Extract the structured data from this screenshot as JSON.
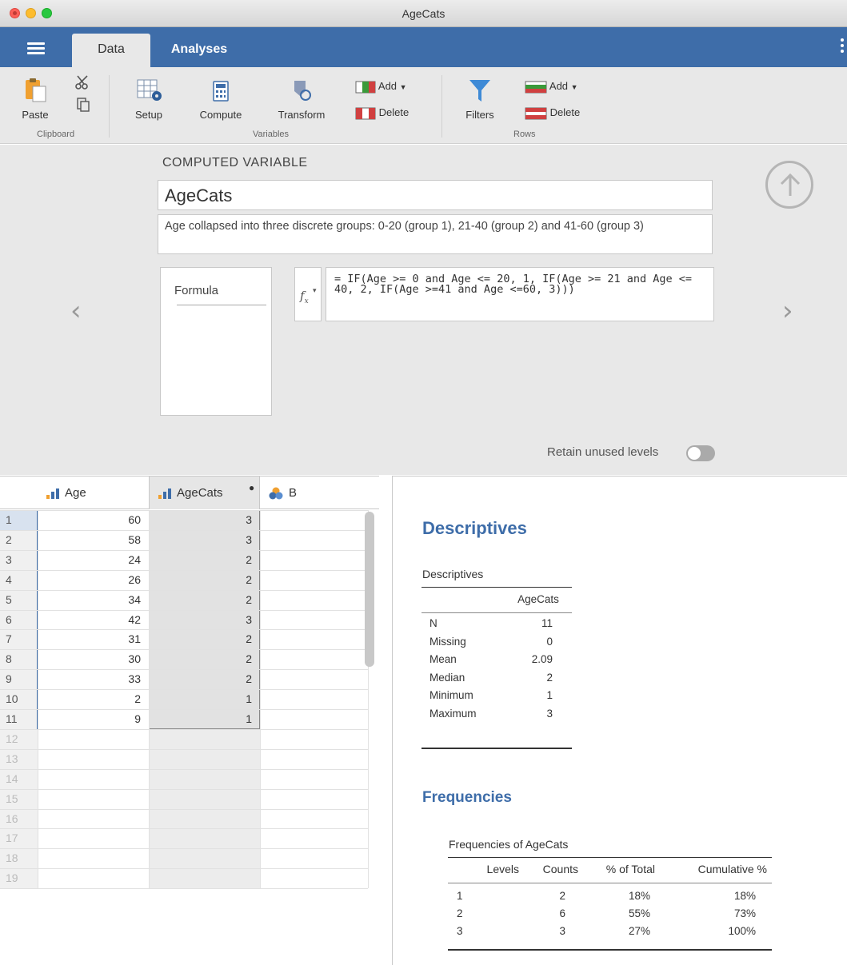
{
  "window": {
    "title": "AgeCats"
  },
  "tabs": {
    "data": "Data",
    "analyses": "Analyses"
  },
  "ribbon": {
    "paste": "Paste",
    "clipboard_group": "Clipboard",
    "setup": "Setup",
    "compute": "Compute",
    "transform": "Transform",
    "variables_group": "Variables",
    "col_add": "Add",
    "col_delete": "Delete",
    "filters": "Filters",
    "row_add": "Add",
    "row_delete": "Delete",
    "rows_group": "Rows"
  },
  "computed": {
    "heading": "COMPUTED VARIABLE",
    "name": "AgeCats",
    "description": "Age collapsed into three discrete groups: 0-20 (group 1), 21-40 (group 2) and 41-60 (group 3)",
    "formula_tab": "Formula",
    "formula": "= IF(Age >= 0 and Age <= 20, 1, IF(Age >= 21 and Age <= 40, 2, IF(Age >=41 and Age <=60, 3)))",
    "retain_label": "Retain unused levels",
    "retain_on": false
  },
  "sheet": {
    "columns": [
      "Age",
      "AgeCats",
      "B"
    ],
    "rows": [
      {
        "n": "1",
        "age": "60",
        "cat": "3"
      },
      {
        "n": "2",
        "age": "58",
        "cat": "3"
      },
      {
        "n": "3",
        "age": "24",
        "cat": "2"
      },
      {
        "n": "4",
        "age": "26",
        "cat": "2"
      },
      {
        "n": "5",
        "age": "34",
        "cat": "2"
      },
      {
        "n": "6",
        "age": "42",
        "cat": "3"
      },
      {
        "n": "7",
        "age": "31",
        "cat": "2"
      },
      {
        "n": "8",
        "age": "30",
        "cat": "2"
      },
      {
        "n": "9",
        "age": "33",
        "cat": "2"
      },
      {
        "n": "10",
        "age": "2",
        "cat": "1"
      },
      {
        "n": "11",
        "age": "9",
        "cat": "1"
      }
    ],
    "empty_rows": [
      "12",
      "13",
      "14",
      "15",
      "16",
      "17",
      "18",
      "19"
    ]
  },
  "results": {
    "desc_title": "Descriptives",
    "desc_caption": "Descriptives",
    "desc_column": "AgeCats",
    "desc_rows": [
      {
        "label": "N",
        "value": "11"
      },
      {
        "label": "Missing",
        "value": "0"
      },
      {
        "label": "Mean",
        "value": "2.09"
      },
      {
        "label": "Median",
        "value": "2"
      },
      {
        "label": "Minimum",
        "value": "1"
      },
      {
        "label": "Maximum",
        "value": "3"
      }
    ],
    "freq_title": "Frequencies",
    "freq_caption": "Frequencies of AgeCats",
    "freq_headers": [
      "Levels",
      "Counts",
      "% of Total",
      "Cumulative %"
    ],
    "freq_rows": [
      {
        "level": "1",
        "count": "2",
        "pct": "18%",
        "cum": "18%"
      },
      {
        "level": "2",
        "count": "6",
        "pct": "55%",
        "cum": "73%"
      },
      {
        "level": "3",
        "count": "3",
        "pct": "27%",
        "cum": "100%"
      }
    ]
  }
}
